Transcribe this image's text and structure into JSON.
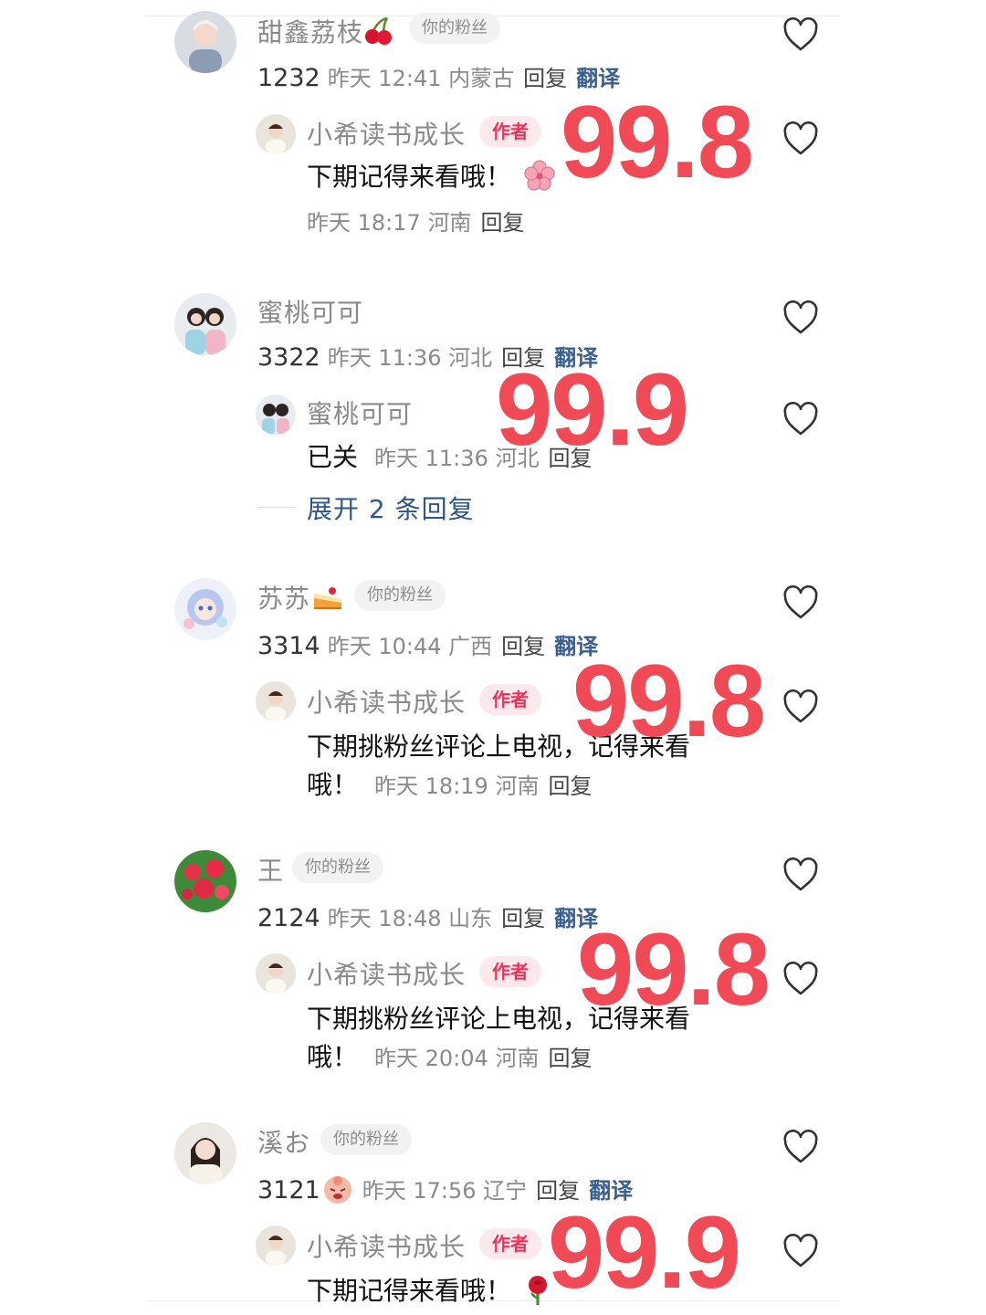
{
  "comments": [
    {
      "name": "甜鑫荔枝",
      "name_emoji": "cherry-icon",
      "badge": "你的粉丝",
      "likes": "1232",
      "time": "昨天 12:41",
      "location": "内蒙古",
      "reply_label": "回复",
      "translate_label": "翻译",
      "reply": {
        "name": "小希读书成长",
        "badge": "作者",
        "text": "下期记得来看哦！",
        "emoji": "cherry-blossom-icon",
        "time": "昨天 18:17",
        "location": "河南",
        "reply_label": "回复"
      },
      "overlay_score": "99.8"
    },
    {
      "name": "蜜桃可可",
      "likes": "3322",
      "time": "昨天 11:36",
      "location": "河北",
      "reply_label": "回复",
      "translate_label": "翻译",
      "reply": {
        "name": "蜜桃可可",
        "text": "已关",
        "time": "昨天 11:36",
        "location": "河北",
        "reply_label": "回复"
      },
      "expand_label": "展开 2 条回复",
      "overlay_score": "99.9"
    },
    {
      "name": "苏苏",
      "name_emoji": "cake-icon",
      "badge": "你的粉丝",
      "likes": "3314",
      "time": "昨天 10:44",
      "location": "广西",
      "reply_label": "回复",
      "translate_label": "翻译",
      "reply": {
        "name": "小希读书成长",
        "badge": "作者",
        "text_line1": "下期挑粉丝评论上电视，记得来看",
        "text_line2": "哦！",
        "time": "昨天 18:19",
        "location": "河南",
        "reply_label": "回复"
      },
      "overlay_score": "99.8"
    },
    {
      "name": "王",
      "badge": "你的粉丝",
      "likes": "2124",
      "time": "昨天 18:48",
      "location": "山东",
      "reply_label": "回复",
      "translate_label": "翻译",
      "reply": {
        "name": "小希读书成长",
        "badge": "作者",
        "text_line1": "下期挑粉丝评论上电视，记得来看",
        "text_line2": "哦！",
        "time": "昨天 20:04",
        "location": "河南",
        "reply_label": "回复"
      },
      "overlay_score": "99.8"
    },
    {
      "name": "溪お",
      "badge": "你的粉丝",
      "likes": "3121",
      "likes_emoji": "crying-face-icon",
      "time": "昨天 17:56",
      "location": "辽宁",
      "reply_label": "回复",
      "translate_label": "翻译",
      "reply": {
        "name": "小希读书成长",
        "badge": "作者",
        "text": "下期记得来看哦！",
        "emoji": "rose-icon"
      },
      "overlay_score": "99.9"
    }
  ],
  "colors": {
    "overlay": "#ef4a55",
    "author_badge_bg": "#fde8ec",
    "author_badge_text": "#e8325a",
    "translate": "#3c5f8f",
    "expand": "#2e5585"
  }
}
